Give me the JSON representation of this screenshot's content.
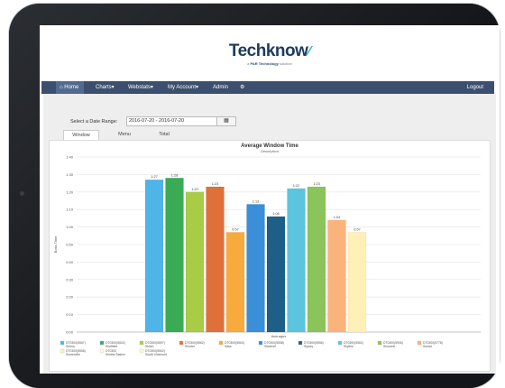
{
  "brand": {
    "name": "Techknow",
    "tagline_prefix": "a",
    "tagline_company": "PAR Technology",
    "tagline_suffix": "solution"
  },
  "nav": {
    "home": "Home",
    "charts": "Charts",
    "webstats": "Webstats",
    "my_account": "My Account",
    "admin": "Admin",
    "logout": "Logout"
  },
  "filter": {
    "date_label": "Select a Date Range:",
    "date_value": "2016-07-20 - 2016-07-20"
  },
  "tabs": [
    {
      "label": "Window",
      "active": true
    },
    {
      "label": "Menu",
      "active": false
    },
    {
      "label": "Total",
      "active": false
    }
  ],
  "colors": {
    "nav_bg": "#3c4f6e",
    "brand_dark": "#1f3a5c",
    "brand_accent": "#2bb3c0"
  },
  "chart_data": {
    "type": "bar",
    "title": "Average Window Time",
    "subtitle": "Description",
    "xlabel": "Averages",
    "ylabel": "Boss Time",
    "ylim": [
      0,
      100
    ],
    "yticks": [
      "0:00",
      "0:10",
      "0:20",
      "0:30",
      "0:40",
      "0:50",
      "1:00",
      "1:10",
      "1:20",
      "1:30",
      "1:40"
    ],
    "grid": true,
    "legend_position": "bottom",
    "series": [
      {
        "name": "DT0300(5567) Selma",
        "value": 87,
        "label": "1:27",
        "color": "#4fb4e8"
      },
      {
        "name": "DT0300(5602) Sheffield",
        "value": 88,
        "label": "1:28",
        "color": "#3aaa55"
      },
      {
        "name": "DT0300(5597) Shiloh",
        "value": 80,
        "label": "1:20",
        "color": "#a8cc45"
      },
      {
        "name": "DT0300(5562) Shorter",
        "value": 83,
        "label": "1:23",
        "color": "#e0703a"
      },
      {
        "name": "DT0300(5563) Sitka",
        "value": 57,
        "label": "0:57",
        "color": "#f8ab3c"
      },
      {
        "name": "DT0300(5558) Silverhill",
        "value": 73,
        "label": "1:13",
        "color": "#3a8fd8"
      },
      {
        "name": "DT0300(5556) Sipsey",
        "value": 66,
        "label": "1:06",
        "color": "#1d5f86"
      },
      {
        "name": "DT0300(5562) Skyline",
        "value": 82,
        "label": "1:22",
        "color": "#5bc4df"
      },
      {
        "name": "DT0300(5906) Slocomb",
        "value": 83,
        "label": "1:23",
        "color": "#8ac45a"
      },
      {
        "name": "DT0300(5778) Snead",
        "value": 64,
        "label": "1:04",
        "color": "#fbb37c"
      },
      {
        "name": "DT0300(5556) Somerville",
        "value": 57,
        "label": "0:57",
        "color": "#fff0b8"
      }
    ],
    "legend_extra": [
      {
        "name": "DT0300 Smiths Station",
        "color": "#fff7d8"
      },
      {
        "name": "DT0300(5502) South Vinemont",
        "color": "#fff7d8"
      }
    ]
  }
}
